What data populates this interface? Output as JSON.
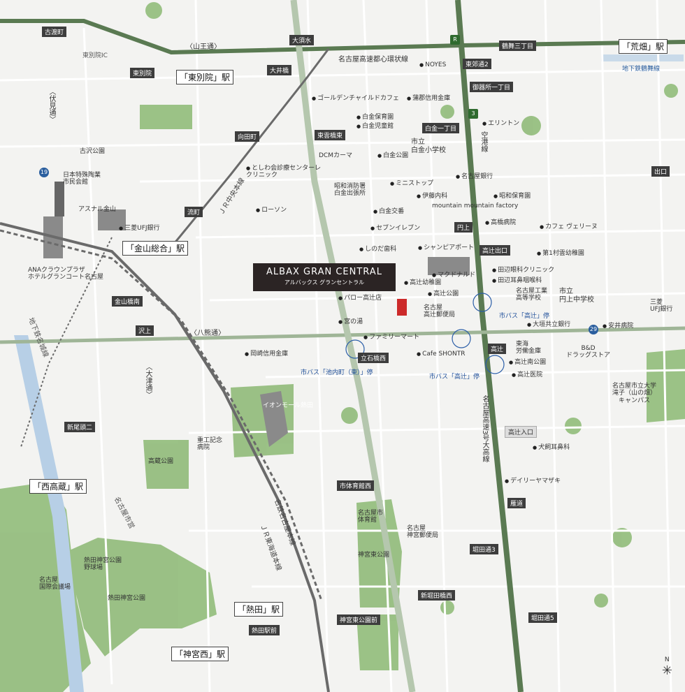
{
  "map": {
    "colors": {
      "road_primary": "#5a7a52",
      "road_secondary": "#ffffff",
      "rail": "#6a6a6a",
      "park": "#86b46e",
      "water": "#b7cfe6",
      "property": "#cc2a2a",
      "building": "#8a8a8a"
    },
    "property": {
      "name": "ALBAX GRAN CENTRAL",
      "subname": "アルバックス グランセントラル"
    },
    "stations": {
      "higashibetsuin": "「東別院」駅",
      "kanayama": "「金山総合」駅",
      "arahata": "「荒畑」駅",
      "nishitakakura": "「西高蔵」駅",
      "atsuta": "「熱田」駅",
      "jinguunishi": "「神宮西」駅"
    },
    "intersections": {
      "furuwataricho": "古渡町",
      "ozusu": "大須水",
      "higashibetsuin": "東別院",
      "tsurumai3": "鶴舞三丁目",
      "tokobashi": "東郊通2",
      "ooibashi": "大井橋",
      "gosho1": "御器所一丁目",
      "higashiunbashi": "東雲橋東",
      "shirogane1": "白金一丁目",
      "mukodacho": "向田町",
      "ryumachi": "流町",
      "enjo": "円上",
      "takatsujideguchi": "高辻出口",
      "kanayamabashi": "金山橋南",
      "sawakami": "沢上",
      "tateishibashi": "立石橋西",
      "takatsuji": "高辻",
      "shinonodata2": "新尾頭二",
      "shiiikukan": "市体育館西",
      "karido": "雁道",
      "horitadori3": "堀田通3",
      "shinhorita": "新堀田橋西",
      "jingutokoen": "神宮東公園前",
      "horitadori5": "堀田通5",
      "atsutaekimae": "熱田駅前",
      "takatsujiiriguchi": "高辻入口",
      "deguchi": "出口",
      "higashibetsuinIC": "東別院IC"
    },
    "roads": {
      "sanno": "〈山王通〉",
      "fushimi": "〈伏見通〉",
      "hatta": "〈八熊通〉",
      "otsu": "〈大津通〉",
      "expressway_ring": "名古屋高速都心環状線",
      "kuko": "空港線",
      "expressway3": "名古屋高速3号大高線",
      "jr_chuo": "ＪＲ中央本線",
      "meitetsu": "名鉄名古屋本線",
      "jr_tokaido": "ＪＲ東海道本線",
      "subway_tsurumai": "地下鉄鶴舞線",
      "subway_meijo": "地下鉄名城線",
      "meiko": "名古屋市営"
    },
    "pois": {
      "noyes": "NOYES",
      "golden": "ゴールデンチャイルドカフェ",
      "gamagori": "蒲郡信用金庫",
      "shirogane_hoiku": "白金保育園",
      "shirogane_jido": "白金児童館",
      "shirogane_koen": "白金公園",
      "shirogane_school": "市立\n白金小学校",
      "dcm": "DCMカーマ",
      "elinton": "エリントン",
      "toshiwa": "としわ会診療センターレ\nクリニック",
      "furusawa": "古沢公園",
      "nihon": "日本特殊陶業\n市民会館",
      "asunal": "アスナル金山",
      "mufg1": "三菱UFJ銀行",
      "lawson": "ローソン",
      "showa_fire": "昭和消防署\n白金出張所",
      "ministop": "ミニストップ",
      "nagoya_bank": "名古屋銀行",
      "ito": "伊藤内科",
      "showa_hoiku": "昭和保育園",
      "mountain": "mountain mountain factory",
      "shirogane_koban": "白金交番",
      "seven": "セブンイレブン",
      "takahashi": "高橋病院",
      "cafe_veriene": "カフェ ヴェリーヌ",
      "shinoda": "しのだ歯科",
      "shampeau": "シャンピアポート",
      "unhoku": "第1村雲幼稚園",
      "tanabe": "田辺眼科クリニック",
      "tanabe_ent": "田辺耳鼻咽喉科",
      "ana": "ANAクラウンプラザ\nホテルグランコート名古屋",
      "takatsuji_yochi": "高辻幼稚園",
      "mcd": "マクドナルド",
      "nagoya_ind": "名古屋工業\n高等学校",
      "enjo_chu": "市立\n円上中学校",
      "paro": "パロー高辻店",
      "takatsuji_koen": "高辻公園",
      "nagoya_post": "名古屋\n高辻郵便局",
      "miyanoyu": "宮の湯",
      "ogaki": "大垣共立銀行",
      "mufg2": "三菱\nUFJ銀行",
      "yasui": "安井病院",
      "family": "ファミリーマート",
      "okazaki": "岡崎信用金庫",
      "cafe_shontr": "Cafe SHONTR",
      "tokai_rodo": "東海\n労働金庫",
      "takatsuji_minami": "高辻南公園",
      "takatsuji_iin": "高辻医院",
      "bd": "B&D\nドラッグストア",
      "nagoya_univ": "名古屋市立大学\n滝子（山の畑）\nキャンパス",
      "aeon": "イオンモール熱田",
      "juu": "重工記念\n病院",
      "takakura": "高蔵公園",
      "inukai": "犬飼耳鼻科",
      "daily": "デイリーヤマザキ",
      "taiikukan": "名古屋市\n体育館",
      "jingu_post": "名古屋\n神宮郵便局",
      "jingu_koen": "神宮東公園",
      "atsuta_baseball": "熱田神宮公園\n野球場",
      "nagoya_kaigi": "名古屋\n国際会議場",
      "atsuta_koen": "熱田神宮公園"
    },
    "bus": {
      "ikeuchi": "市バス「池内町（東）」停",
      "takatsuji_a": "市バス「高辻」停",
      "takatsuji_b": "市バス「高辻」停"
    },
    "shields": {
      "r": "R",
      "three": "3",
      "nineteen": "19",
      "twentynine": "29"
    },
    "compass": "N"
  }
}
